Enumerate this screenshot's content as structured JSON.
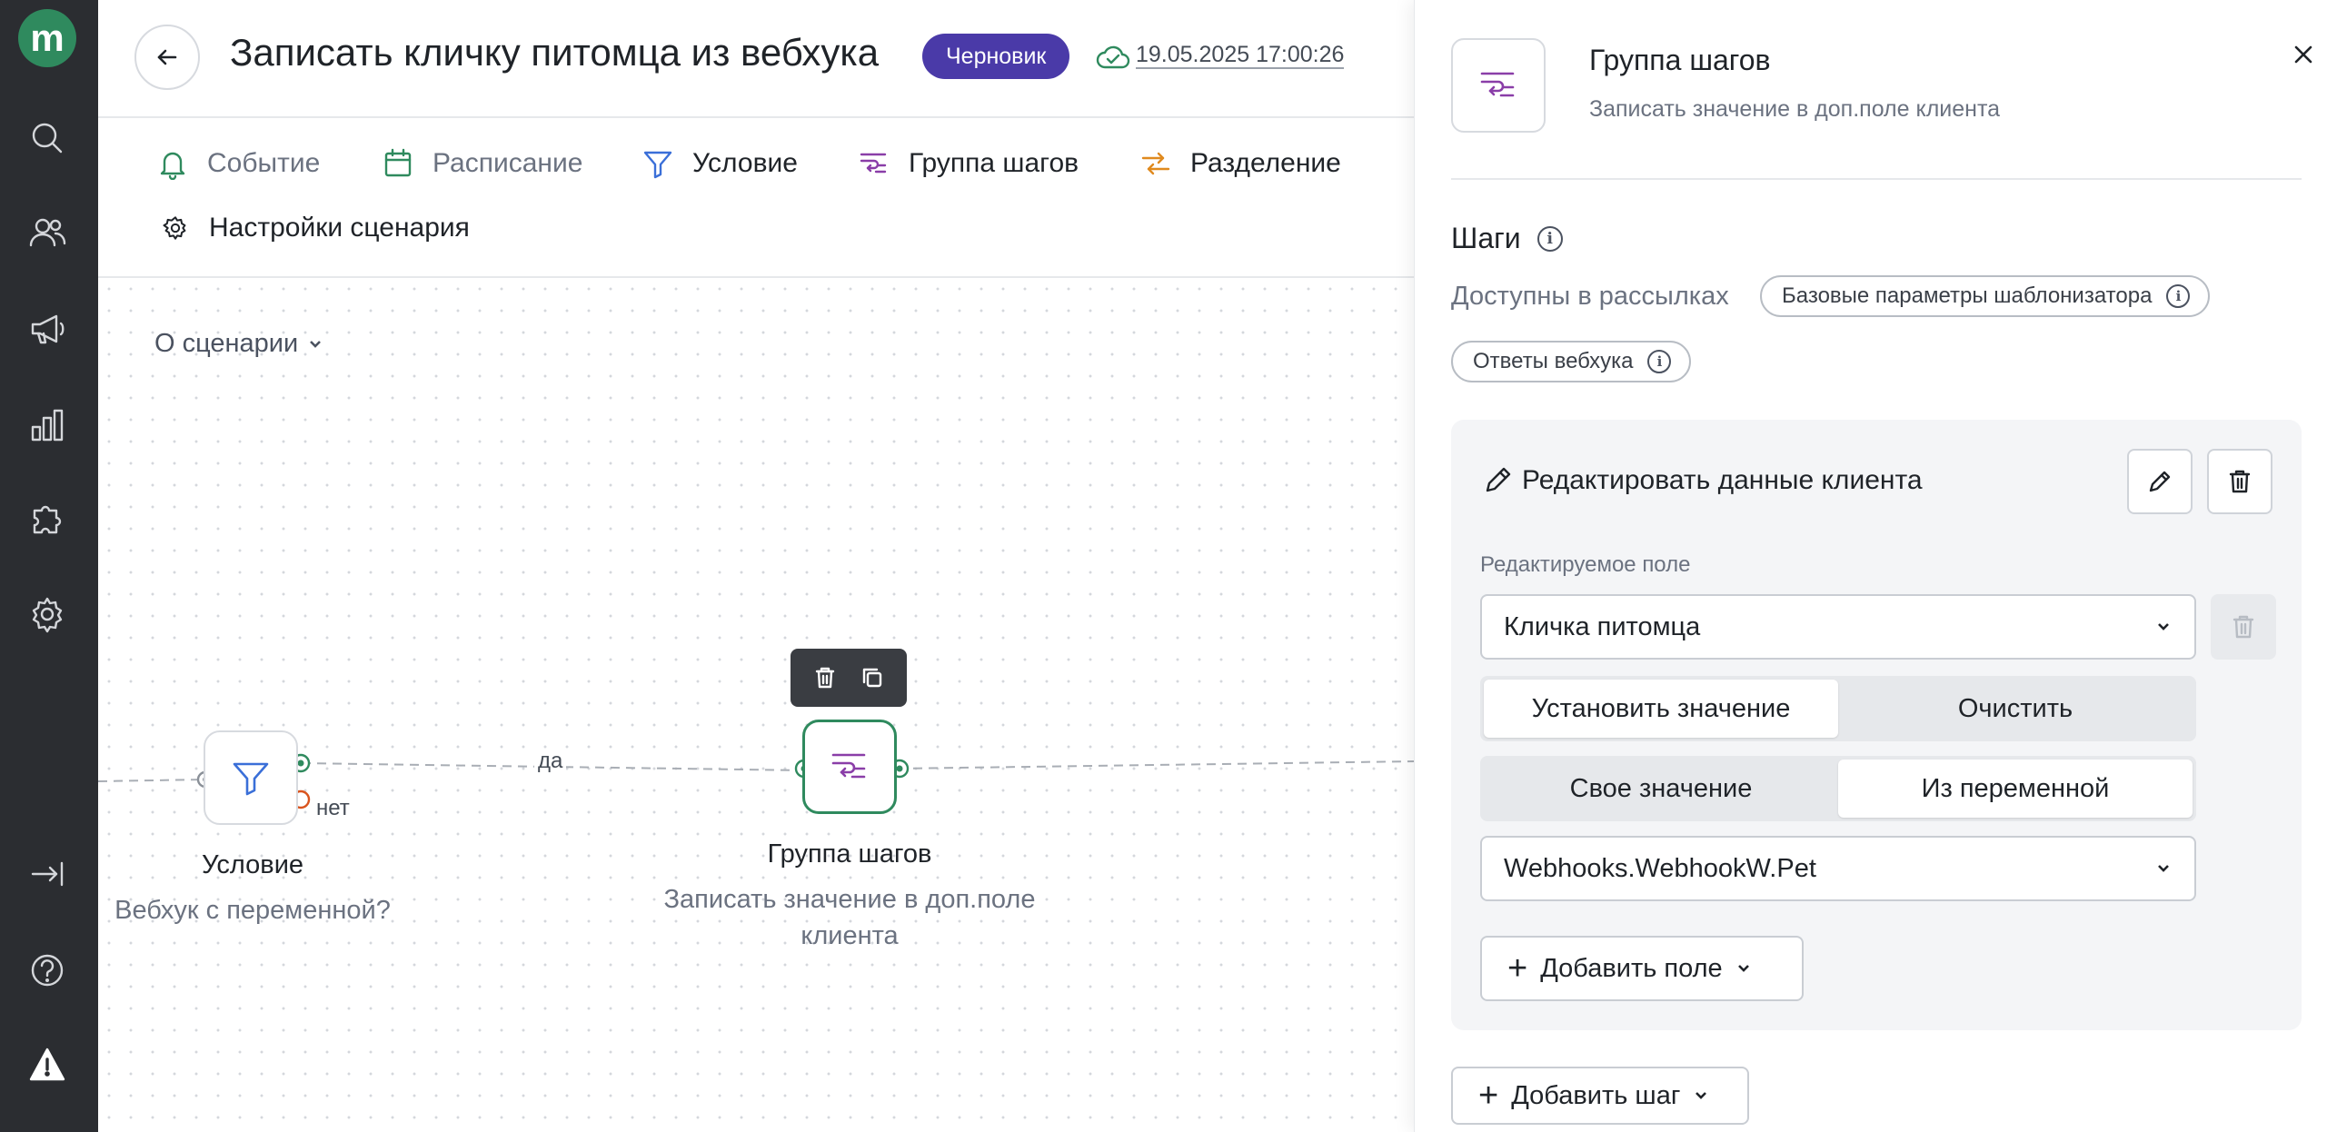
{
  "app": {
    "logo_letter": "m"
  },
  "rail": {
    "items": [
      "search-icon",
      "users-icon",
      "megaphone-icon",
      "analytics-icon",
      "puzzle-icon",
      "settings-icon",
      "collapse-icon",
      "help-icon",
      "warning-icon"
    ]
  },
  "header": {
    "title": "Записать кличку питомца из вебхука",
    "status": "Черновик",
    "saved_time": "19.05.2025 17:00:26",
    "colors": {
      "status_bg": "#4a3aa8",
      "accent": "#2f8a5e"
    }
  },
  "toolbar": {
    "event": "Событие",
    "schedule": "Расписание",
    "condition": "Условие",
    "step_group": "Группа шагов",
    "split": "Разделение",
    "settings": "Настройки сценария"
  },
  "canvas": {
    "about": "О сценарии",
    "edge_yes": "да",
    "edge_no": "нет",
    "condition_node": {
      "title": "Условие",
      "subtitle": "Вебхук с переменной?"
    },
    "group_node": {
      "title": "Группа шагов",
      "subtitle": "Записать значение в доп.поле клиента"
    }
  },
  "panel": {
    "title": "Группа шагов",
    "subtitle": "Записать значение в доп.поле клиента",
    "steps_title": "Шаги",
    "available_label": "Доступны в рассылках",
    "chips": [
      "Базовые параметры шаблонизатора",
      "Ответы вебхука"
    ],
    "card": {
      "title": "Редактировать данные клиента",
      "field_label": "Редактируемое поле",
      "field_value": "Кличка питомца",
      "mode": {
        "set": "Установить значение",
        "clear": "Очистить",
        "active": "set"
      },
      "source": {
        "own": "Свое значение",
        "variable": "Из переменной",
        "active": "variable"
      },
      "variable_value": "Webhooks.WebhookW.Pet",
      "add_field": "Добавить поле"
    },
    "add_step": "Добавить шаг"
  }
}
